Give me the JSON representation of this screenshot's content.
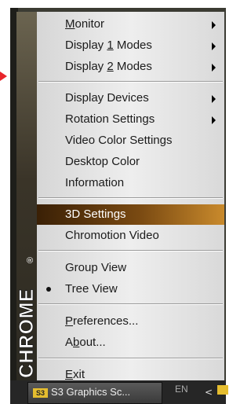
{
  "brand": {
    "text": "CHROME",
    "mark": "®"
  },
  "menu": {
    "items": [
      {
        "label": "Monitor",
        "mnemonic": "M",
        "submenu": true
      },
      {
        "label": "Display 1 Modes",
        "mnemonic": "1",
        "submenu": true
      },
      {
        "label": "Display 2 Modes",
        "mnemonic": "2",
        "submenu": true
      },
      {
        "label": "Display Devices",
        "submenu": true
      },
      {
        "label": "Rotation Settings",
        "submenu": true
      },
      {
        "label": "Video Color Settings"
      },
      {
        "label": "Desktop Color"
      },
      {
        "label": "Information"
      },
      {
        "label": "3D Settings",
        "highlighted": true
      },
      {
        "label": "Chromotion Video"
      },
      {
        "label": "Group View"
      },
      {
        "label": "Tree View",
        "checked": true
      },
      {
        "label": "Preferences...",
        "mnemonic": "P"
      },
      {
        "label": "About...",
        "mnemonic": "b"
      },
      {
        "label": "Exit",
        "mnemonic": "E"
      }
    ]
  },
  "taskbar": {
    "window_button": "S3 Graphics Sc...",
    "window_icon_text": "S3",
    "language": "EN",
    "tray_chevron": "<"
  },
  "colors": {
    "highlight_start": "#3a2006",
    "highlight_end": "#c98a2c",
    "pointer": "#e8252b"
  }
}
